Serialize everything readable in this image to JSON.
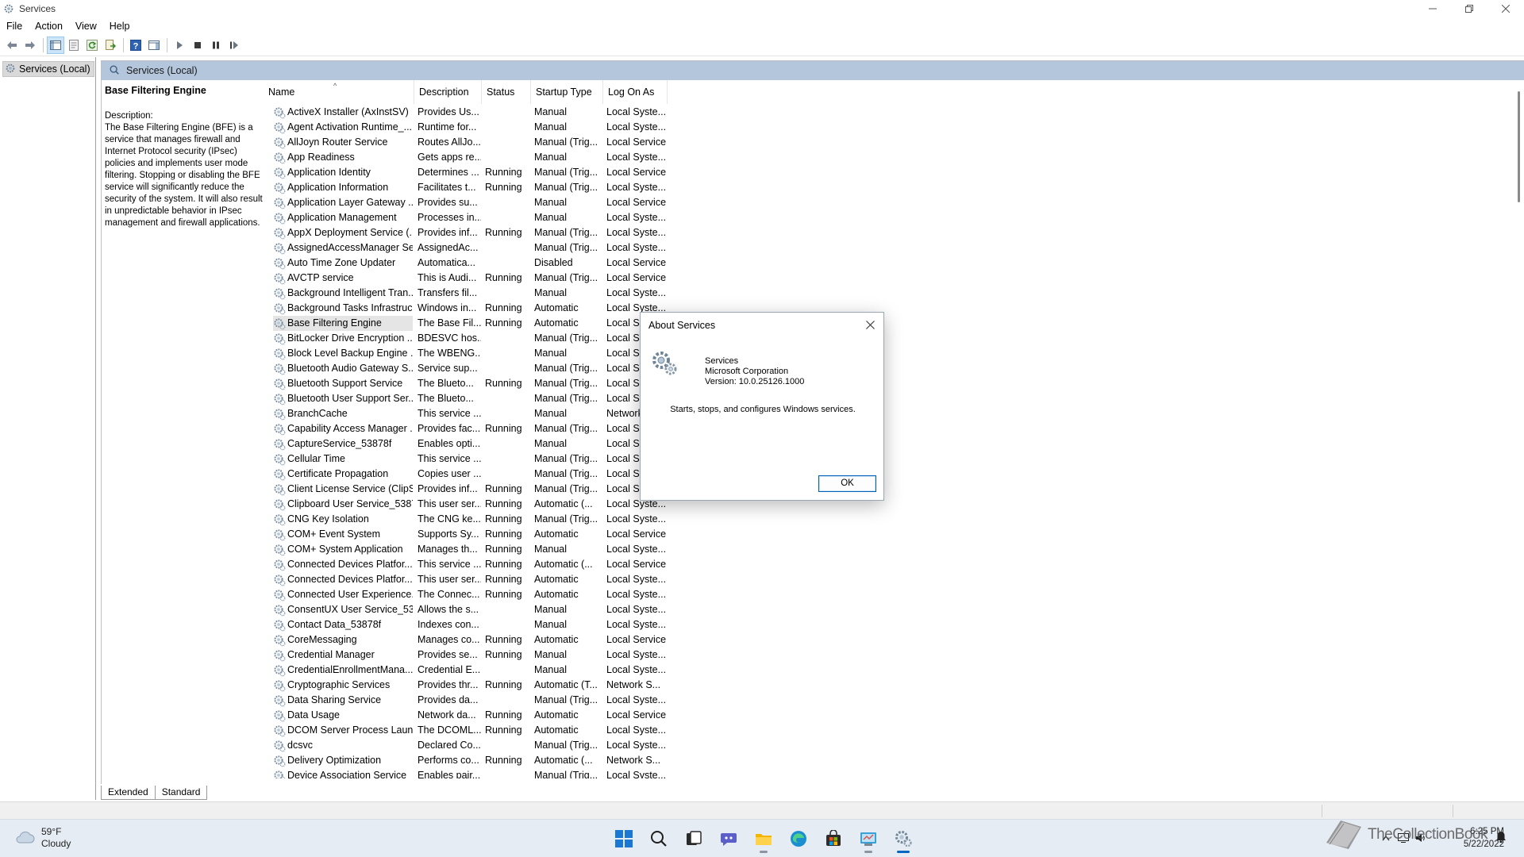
{
  "window": {
    "title": "Services",
    "controls": [
      "minimize",
      "restore",
      "close"
    ]
  },
  "menu": [
    "File",
    "Action",
    "View",
    "Help"
  ],
  "toolbar": {
    "buttons": [
      "back-icon",
      "forward-icon",
      "show-hide-tree-icon",
      "properties-icon",
      "refresh-icon",
      "export-list-icon",
      "help-icon",
      "show-hide-action-pane-icon",
      "start-service-icon",
      "stop-service-icon",
      "pause-service-icon",
      "restart-service-icon"
    ]
  },
  "tree": {
    "item": "Services (Local)"
  },
  "panel": {
    "header": "Services (Local)",
    "selected_service": "Base Filtering Engine",
    "description_label": "Description:",
    "description": "The Base Filtering Engine (BFE) is a service that manages firewall and Internet Protocol security (IPsec) policies and implements user mode filtering. Stopping or disabling the BFE service will significantly reduce the security of the system. It will also result in unpredictable behavior in IPsec management and firewall applications."
  },
  "columns": [
    "Name",
    "Description",
    "Status",
    "Startup Type",
    "Log On As"
  ],
  "services": [
    [
      "ActiveX Installer (AxInstSV)",
      "Provides Us...",
      "",
      "Manual",
      "Local Syste..."
    ],
    [
      "Agent Activation Runtime_...",
      "Runtime for...",
      "",
      "Manual",
      "Local Syste..."
    ],
    [
      "AllJoyn Router Service",
      "Routes AllJo...",
      "",
      "Manual (Trig...",
      "Local Service"
    ],
    [
      "App Readiness",
      "Gets apps re...",
      "",
      "Manual",
      "Local Syste..."
    ],
    [
      "Application Identity",
      "Determines ...",
      "Running",
      "Manual (Trig...",
      "Local Service"
    ],
    [
      "Application Information",
      "Facilitates t...",
      "Running",
      "Manual (Trig...",
      "Local Syste..."
    ],
    [
      "Application Layer Gateway ...",
      "Provides su...",
      "",
      "Manual",
      "Local Service"
    ],
    [
      "Application Management",
      "Processes in...",
      "",
      "Manual",
      "Local Syste..."
    ],
    [
      "AppX Deployment Service (...",
      "Provides inf...",
      "Running",
      "Manual (Trig...",
      "Local Syste..."
    ],
    [
      "AssignedAccessManager Se...",
      "AssignedAc...",
      "",
      "Manual (Trig...",
      "Local Syste..."
    ],
    [
      "Auto Time Zone Updater",
      "Automatica...",
      "",
      "Disabled",
      "Local Service"
    ],
    [
      "AVCTP service",
      "This is Audi...",
      "Running",
      "Manual (Trig...",
      "Local Service"
    ],
    [
      "Background Intelligent Tran...",
      "Transfers fil...",
      "",
      "Manual",
      "Local Syste..."
    ],
    [
      "Background Tasks Infrastruc...",
      "Windows in...",
      "Running",
      "Automatic",
      "Local Syste..."
    ],
    [
      "Base Filtering Engine",
      "The Base Fil...",
      "Running",
      "Automatic",
      "Local Se..."
    ],
    [
      "BitLocker Drive Encryption ...",
      "BDESVC hos...",
      "",
      "Manual (Trig...",
      "Local Sy..."
    ],
    [
      "Block Level Backup Engine ...",
      "The WBENG...",
      "",
      "Manual",
      "Local Sy..."
    ],
    [
      "Bluetooth Audio Gateway S...",
      "Service sup...",
      "",
      "Manual (Trig...",
      "Local Se..."
    ],
    [
      "Bluetooth Support Service",
      "The Blueto...",
      "Running",
      "Manual (Trig...",
      "Local Se..."
    ],
    [
      "Bluetooth User Support Ser...",
      "The Blueto...",
      "",
      "Manual (Trig...",
      "Local Sy..."
    ],
    [
      "BranchCache",
      "This service ...",
      "",
      "Manual",
      "Network..."
    ],
    [
      "Capability Access Manager ...",
      "Provides fac...",
      "Running",
      "Manual (Trig...",
      "Local Sy..."
    ],
    [
      "CaptureService_53878f",
      "Enables opti...",
      "",
      "Manual",
      "Local Sy..."
    ],
    [
      "Cellular Time",
      "This service ...",
      "",
      "Manual (Trig...",
      "Local Se..."
    ],
    [
      "Certificate Propagation",
      "Copies user ...",
      "",
      "Manual (Trig...",
      "Local Sy..."
    ],
    [
      "Client License Service (ClipS...",
      "Provides inf...",
      "Running",
      "Manual (Trig...",
      "Local Sy..."
    ],
    [
      "Clipboard User Service_5387...",
      "This user ser...",
      "Running",
      "Automatic (...",
      "Local Syste..."
    ],
    [
      "CNG Key Isolation",
      "The CNG ke...",
      "Running",
      "Manual (Trig...",
      "Local Syste..."
    ],
    [
      "COM+ Event System",
      "Supports Sy...",
      "Running",
      "Automatic",
      "Local Service"
    ],
    [
      "COM+ System Application",
      "Manages th...",
      "Running",
      "Manual",
      "Local Syste..."
    ],
    [
      "Connected Devices Platfor...",
      "This service ...",
      "Running",
      "Automatic (...",
      "Local Service"
    ],
    [
      "Connected Devices Platfor...",
      "This user ser...",
      "Running",
      "Automatic",
      "Local Syste..."
    ],
    [
      "Connected User Experience...",
      "The Connec...",
      "Running",
      "Automatic",
      "Local Syste..."
    ],
    [
      "ConsentUX User Service_53...",
      "Allows the s...",
      "",
      "Manual",
      "Local Syste..."
    ],
    [
      "Contact Data_53878f",
      "Indexes con...",
      "",
      "Manual",
      "Local Syste..."
    ],
    [
      "CoreMessaging",
      "Manages co...",
      "Running",
      "Automatic",
      "Local Service"
    ],
    [
      "Credential Manager",
      "Provides se...",
      "Running",
      "Manual",
      "Local Syste..."
    ],
    [
      "CredentialEnrollmentMana...",
      "Credential E...",
      "",
      "Manual",
      "Local Syste..."
    ],
    [
      "Cryptographic Services",
      "Provides thr...",
      "Running",
      "Automatic (T...",
      "Network S..."
    ],
    [
      "Data Sharing Service",
      "Provides da...",
      "",
      "Manual (Trig...",
      "Local Syste..."
    ],
    [
      "Data Usage",
      "Network da...",
      "Running",
      "Automatic",
      "Local Service"
    ],
    [
      "DCOM Server Process Laun...",
      "The DCOML...",
      "Running",
      "Automatic",
      "Local Syste..."
    ],
    [
      "dcsvc",
      "Declared Co...",
      "",
      "Manual (Trig...",
      "Local Syste..."
    ],
    [
      "Delivery Optimization",
      "Performs co...",
      "Running",
      "Automatic (...",
      "Network S..."
    ],
    [
      "Device Association Service",
      "Enables pair...",
      "",
      "Manual (Trig...",
      "Local Syste..."
    ]
  ],
  "tabs": [
    "Extended",
    "Standard"
  ],
  "dialog": {
    "title": "About Services",
    "product": "Services",
    "company": "Microsoft Corporation",
    "version": "Version: 10.0.25126.1000",
    "message": "Starts, stops, and configures Windows services.",
    "ok_label": "OK"
  },
  "taskbar": {
    "weather_temp": "59°F",
    "weather_desc": "Cloudy",
    "apps": [
      "start-icon",
      "search-icon",
      "task-view-icon",
      "chat-icon",
      "file-explorer-icon",
      "edge-icon",
      "store-icon",
      "control-panel-icon",
      "services-icon"
    ],
    "time": "6:25 PM",
    "date": "5/22/2022"
  },
  "watermark": {
    "text": "TheCollectionBook"
  },
  "colors": {
    "header_bg": "#b3c6dc",
    "selection": "#e5e5e5",
    "taskbar_bg": "#e6ecf3",
    "accent": "#0067c0"
  }
}
